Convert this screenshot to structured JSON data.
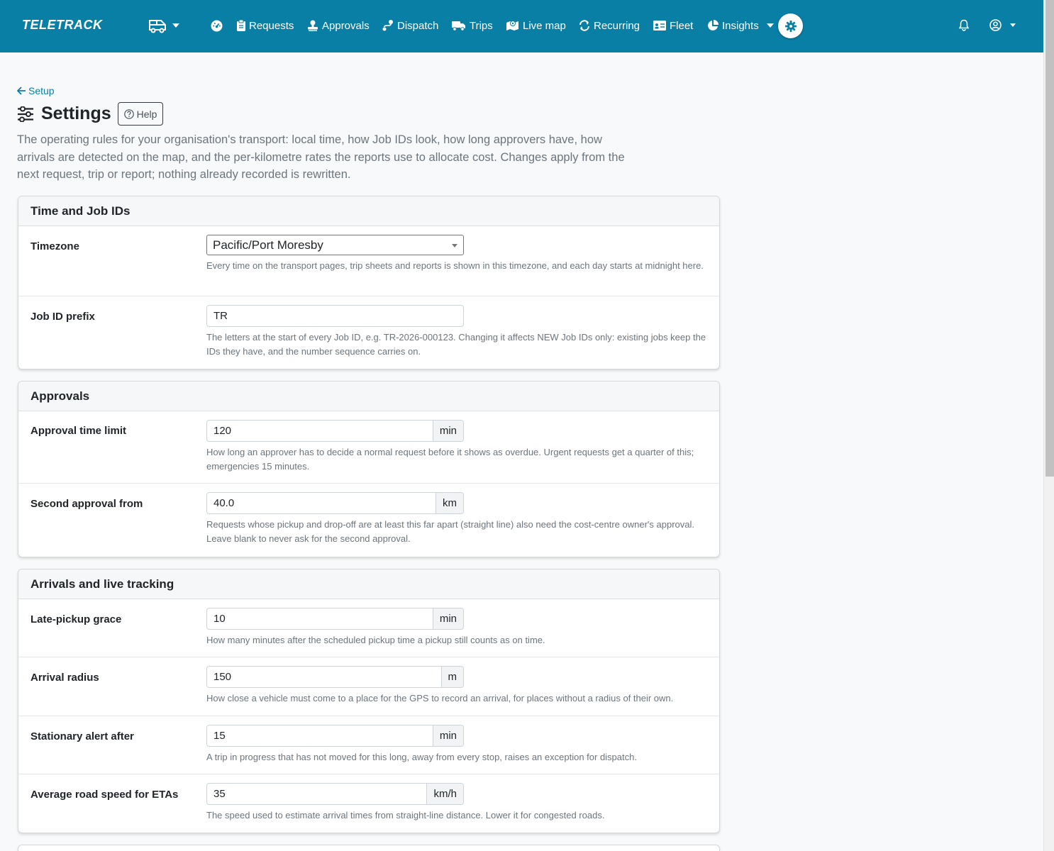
{
  "nav": {
    "brand": "TELETRACK",
    "items": [
      {
        "label": "Requests",
        "icon": "clipboard-icon"
      },
      {
        "label": "Approvals",
        "icon": "stamp-icon"
      },
      {
        "label": "Dispatch",
        "icon": "route-icon"
      },
      {
        "label": "Trips",
        "icon": "truck-icon"
      },
      {
        "label": "Live map",
        "icon": "map-icon"
      },
      {
        "label": "Recurring",
        "icon": "repeat-icon"
      },
      {
        "label": "Fleet",
        "icon": "id-card-icon"
      },
      {
        "label": "Insights",
        "icon": "pie-chart-icon"
      }
    ]
  },
  "header": {
    "back_label": "Setup",
    "title": "Settings",
    "help_label": "Help",
    "intro": "The operating rules for your organisation's transport: local time, how Job IDs look, how long approvers have, how arrivals are detected on the map, and the per-kilometre rates the reports use to allocate cost. Changes apply from the next request, trip or report; nothing already recorded is rewritten."
  },
  "sections": {
    "time": {
      "title": "Time and Job IDs",
      "timezone": {
        "label": "Timezone",
        "value": "Pacific/Port Moresby",
        "help": "Every time on the transport pages, trip sheets and reports is shown in this timezone, and each day starts at midnight here."
      },
      "prefix": {
        "label": "Job ID prefix",
        "value": "TR",
        "help": "The letters at the start of every Job ID, e.g. TR-2026-000123. Changing it affects NEW Job IDs only: existing jobs keep the IDs they have, and the number sequence carries on."
      }
    },
    "approvals": {
      "title": "Approvals",
      "time_limit": {
        "label": "Approval time limit",
        "value": "120",
        "unit": "min",
        "help": "How long an approver has to decide a normal request before it shows as overdue. Urgent requests get a quarter of this; emergencies 15 minutes."
      },
      "second": {
        "label": "Second approval from",
        "value": "40.0",
        "unit": "km",
        "help": "Requests whose pickup and drop-off are at least this far apart (straight line) also need the cost-centre owner's approval. Leave blank to never ask for the second approval."
      }
    },
    "arrivals": {
      "title": "Arrivals and live tracking",
      "grace": {
        "label": "Late-pickup grace",
        "value": "10",
        "unit": "min",
        "help": "How many minutes after the scheduled pickup time a pickup still counts as on time."
      },
      "radius": {
        "label": "Arrival radius",
        "value": "150",
        "unit": "m",
        "help": "How close a vehicle must come to a place for the GPS to record an arrival, for places without a radius of their own."
      },
      "stationary": {
        "label": "Stationary alert after",
        "value": "15",
        "unit": "min",
        "help": "A trip in progress that has not moved for this long, away from every stop, raises an exception for dispatch."
      },
      "speed": {
        "label": "Average road speed for ETAs",
        "value": "35",
        "unit": "km/h",
        "help": "The speed used to estimate arrival times from straight-line distance. Lower it for congested roads."
      }
    }
  }
}
